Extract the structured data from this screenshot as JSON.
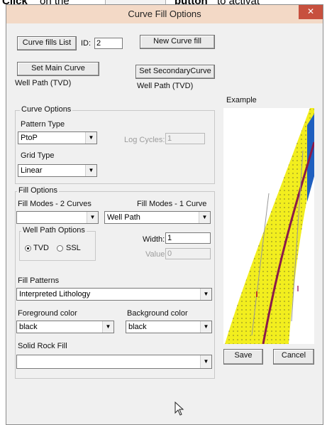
{
  "caption": {
    "left": "Click",
    "middle": "on the",
    "right": "button",
    "tail": "to activat"
  },
  "window": {
    "title": "Curve Fill Options",
    "close_glyph": "✕"
  },
  "top": {
    "curve_fills_list": "Curve fills List",
    "id_label": "ID:",
    "id_value": "2",
    "new_curve_fill": "New Curve fill",
    "set_main_curve": "Set Main Curve",
    "main_curve_value": "Well Path (TVD)",
    "set_secondary_curve": "Set SecondaryCurve",
    "secondary_curve_value": "Well Path (TVD)",
    "example_label": "Example"
  },
  "curve_options": {
    "legend": "Curve Options",
    "pattern_type_label": "Pattern Type",
    "pattern_type_value": "PtoP",
    "log_cycles_label": "Log Cycles:",
    "log_cycles_value": "1",
    "grid_type_label": "Grid Type",
    "grid_type_value": "Linear"
  },
  "fill_options": {
    "legend": "Fill Options",
    "fill_modes_2_label": "Fill Modes - 2 Curves",
    "fill_modes_2_value": "",
    "fill_modes_1_label": "Fill Modes - 1 Curve",
    "fill_modes_1_value": "Well Path",
    "well_path_options_legend": "Well Path Options",
    "tvd_label": "TVD",
    "ssl_label": "SSL",
    "width_label": "Width:",
    "width_value": "1",
    "value_label": "Value:",
    "value_value": "0",
    "fill_patterns_label": "Fill Patterns",
    "fill_patterns_value": "Interpreted Lithology",
    "foreground_label": "Foreground color",
    "foreground_value": "black",
    "background_label": "Background color",
    "background_value": "black",
    "solid_rock_label": "Solid Rock Fill",
    "solid_rock_value": ""
  },
  "actions": {
    "save": "Save",
    "cancel": "Cancel"
  },
  "colors": {
    "fill_yellow": "#f2ee1e",
    "well_path": "#8b1a4a",
    "blue_band": "#1f5fbf",
    "title_bar": "#f3d9c6",
    "close_red": "#c7503e"
  }
}
